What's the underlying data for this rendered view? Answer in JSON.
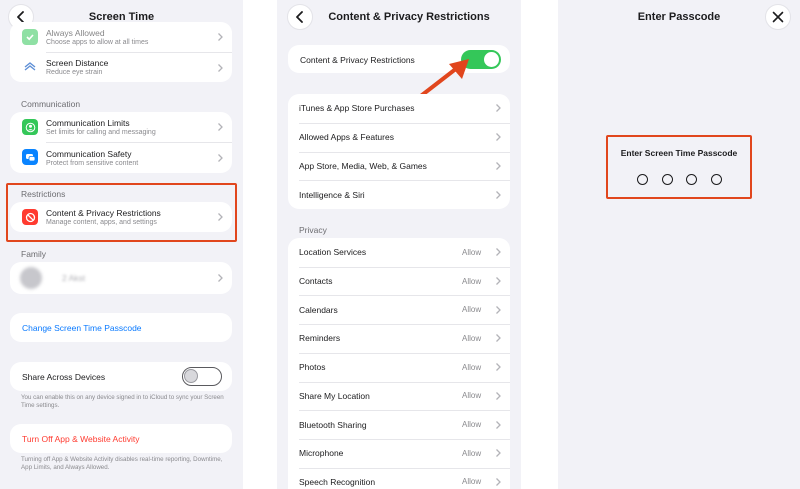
{
  "screen_time": {
    "title": "Screen Time",
    "rows_top": [
      {
        "title": "Always Allowed",
        "subtitle": "Choose apps to allow at all times",
        "icon": "checkmark-icon",
        "color": "#34c759"
      },
      {
        "title": "Screen Distance",
        "subtitle": "Reduce eye strain",
        "icon": "screen-distance-icon",
        "color": "#5e8fd6"
      }
    ],
    "communication_header": "Communication",
    "communication": [
      {
        "title": "Communication Limits",
        "subtitle": "Set limits for calling and messaging",
        "icon": "person-circle-icon",
        "color": "#34c759"
      },
      {
        "title": "Communication Safety",
        "subtitle": "Protect from sensitive content",
        "icon": "chat-bubble-icon",
        "color": "#0a84ff"
      }
    ],
    "restrictions_header": "Restrictions",
    "restrictions_row": {
      "title": "Content & Privacy Restrictions",
      "subtitle": "Manage content, apps, and settings",
      "icon": "prohibited-icon",
      "color": "#ff3b30"
    },
    "family_header": "Family",
    "family_name": "2 Akst",
    "change_passcode": "Change Screen Time Passcode",
    "share_across_devices": "Share Across Devices",
    "share_footer": "You can enable this on any device signed in to iCloud to sync your Screen Time settings.",
    "turn_off": "Turn Off App & Website Activity",
    "turn_off_footer": "Turning off App & Website Activity disables real-time reporting, Downtime, App Limits, and Always Allowed."
  },
  "restrictions": {
    "title": "Content & Privacy Restrictions",
    "toggle_label": "Content & Privacy Restrictions",
    "toggle_on": true,
    "toggle_color": "#34c759",
    "store_items": [
      "iTunes & App Store Purchases",
      "Allowed Apps & Features",
      "App Store, Media, Web, & Games",
      "Intelligence & Siri"
    ],
    "privacy_header": "Privacy",
    "privacy_items": [
      {
        "label": "Location Services",
        "value": "Allow"
      },
      {
        "label": "Contacts",
        "value": "Allow"
      },
      {
        "label": "Calendars",
        "value": "Allow"
      },
      {
        "label": "Reminders",
        "value": "Allow"
      },
      {
        "label": "Photos",
        "value": "Allow"
      },
      {
        "label": "Share My Location",
        "value": "Allow"
      },
      {
        "label": "Bluetooth Sharing",
        "value": "Allow"
      },
      {
        "label": "Microphone",
        "value": "Allow"
      },
      {
        "label": "Speech Recognition",
        "value": "Allow"
      }
    ]
  },
  "passcode": {
    "title": "Enter Passcode",
    "prompt": "Enter Screen Time Passcode",
    "digits": 4
  },
  "colors": {
    "highlight": "#e1461d",
    "link_blue": "#0a7aff",
    "destructive_red": "#ff3b30"
  }
}
